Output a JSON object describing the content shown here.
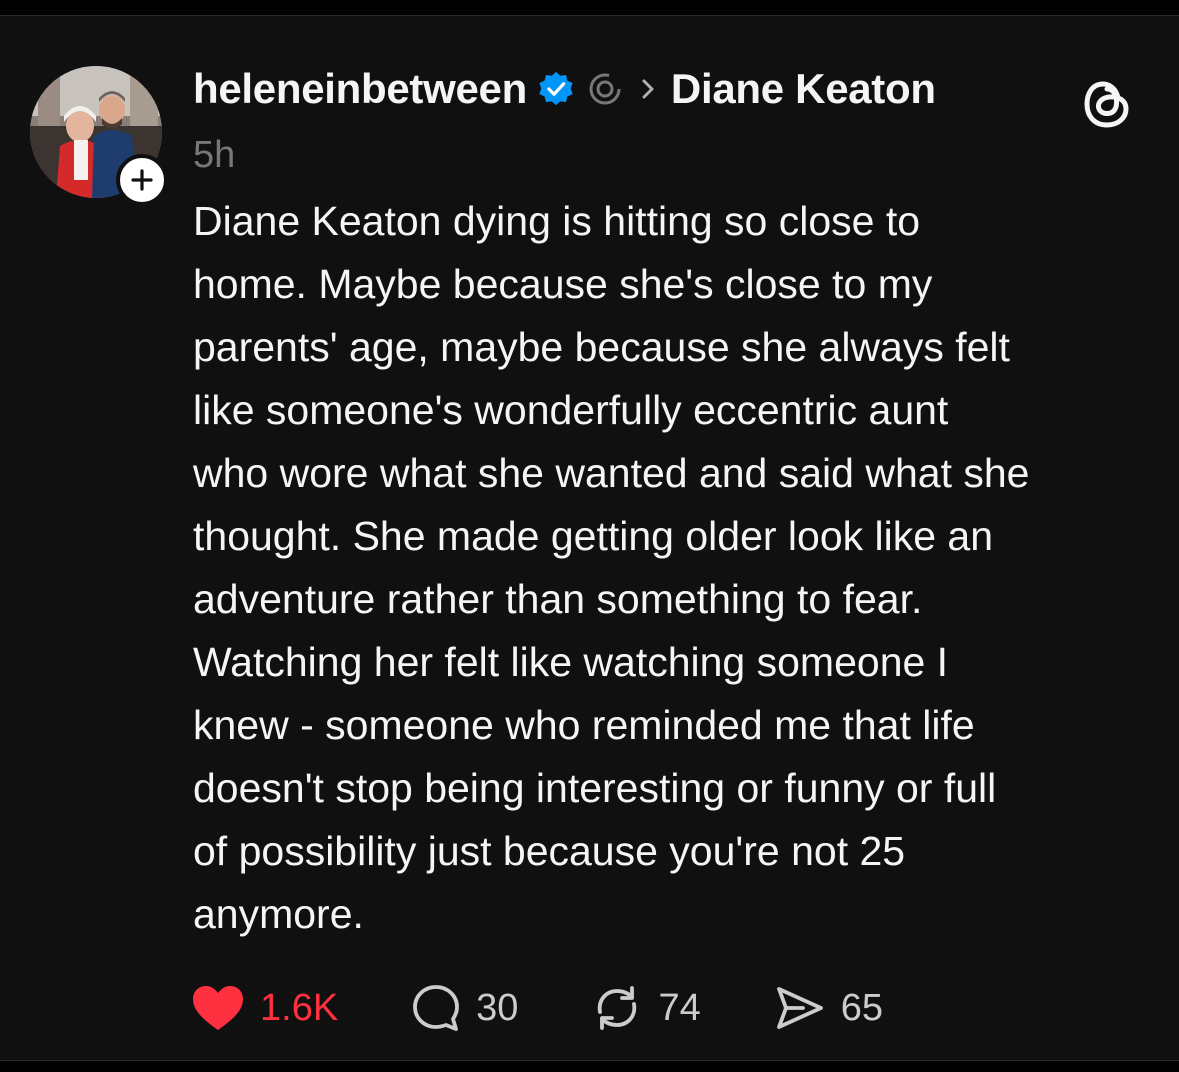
{
  "post": {
    "username": "heleneinbetween",
    "topic": "Diane Keaton",
    "time": "5h",
    "text": "Diane Keaton dying is hitting so close to\nhome. Maybe because she's close to my\nparents' age, maybe because she always felt\nlike someone's wonderfully eccentric aunt\nwho wore what she wanted and said what she\nthought. She made getting older look like an\nadventure rather than something to fear.\nWatching her felt like watching someone I\nknew - someone who reminded me that life\ndoesn't stop being interesting or funny or full\nof possibility just because you're not 25\nanymore.",
    "icons": {
      "verified": "verified-badge-icon",
      "ring": "ring-icon",
      "chevron": "chevron-right-icon",
      "logo": "threads-logo-icon",
      "follow": "plus-icon"
    }
  },
  "actions": {
    "likes": "1.6K",
    "replies": "30",
    "reposts": "74",
    "shares": "65"
  },
  "colors": {
    "background": "#101010",
    "text": "#f3f5f7",
    "muted": "#777777",
    "like": "#ff3040",
    "verified": "#0095f6"
  }
}
